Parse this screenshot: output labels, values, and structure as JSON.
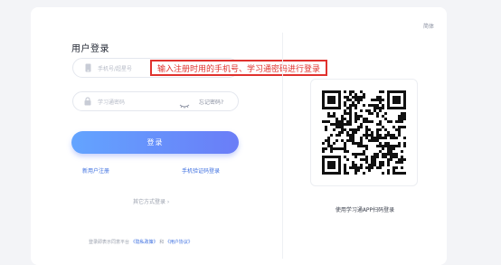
{
  "header": {
    "language": "简体"
  },
  "login": {
    "title": "用户登录",
    "phone_placeholder": "手机号/超星号",
    "password_placeholder": "学习通密码",
    "forgot_label": "忘记密码?",
    "login_button": "登录",
    "register_link": "新用户注册",
    "sms_login_link": "手机验证码登录",
    "other_methods": "其它方式登录 ›",
    "agreement_prefix": "登录即表示同意平台",
    "privacy_link": "《隐私政策》",
    "agreement_and": "和",
    "user_agreement_link": "《用户协议》"
  },
  "annotation": {
    "tip_text": "输入注册时用的手机号、学习通密码进行登录",
    "color": "#e0322e"
  },
  "qr": {
    "caption": "使用学习通APP扫码登录"
  },
  "colors": {
    "accent": "#3d6fe0",
    "button_start": "#63a4ff",
    "button_end": "#6a7df7"
  },
  "icons": {
    "phone": "phone-icon",
    "lock": "lock-icon",
    "eye": "eye-closed-icon"
  }
}
